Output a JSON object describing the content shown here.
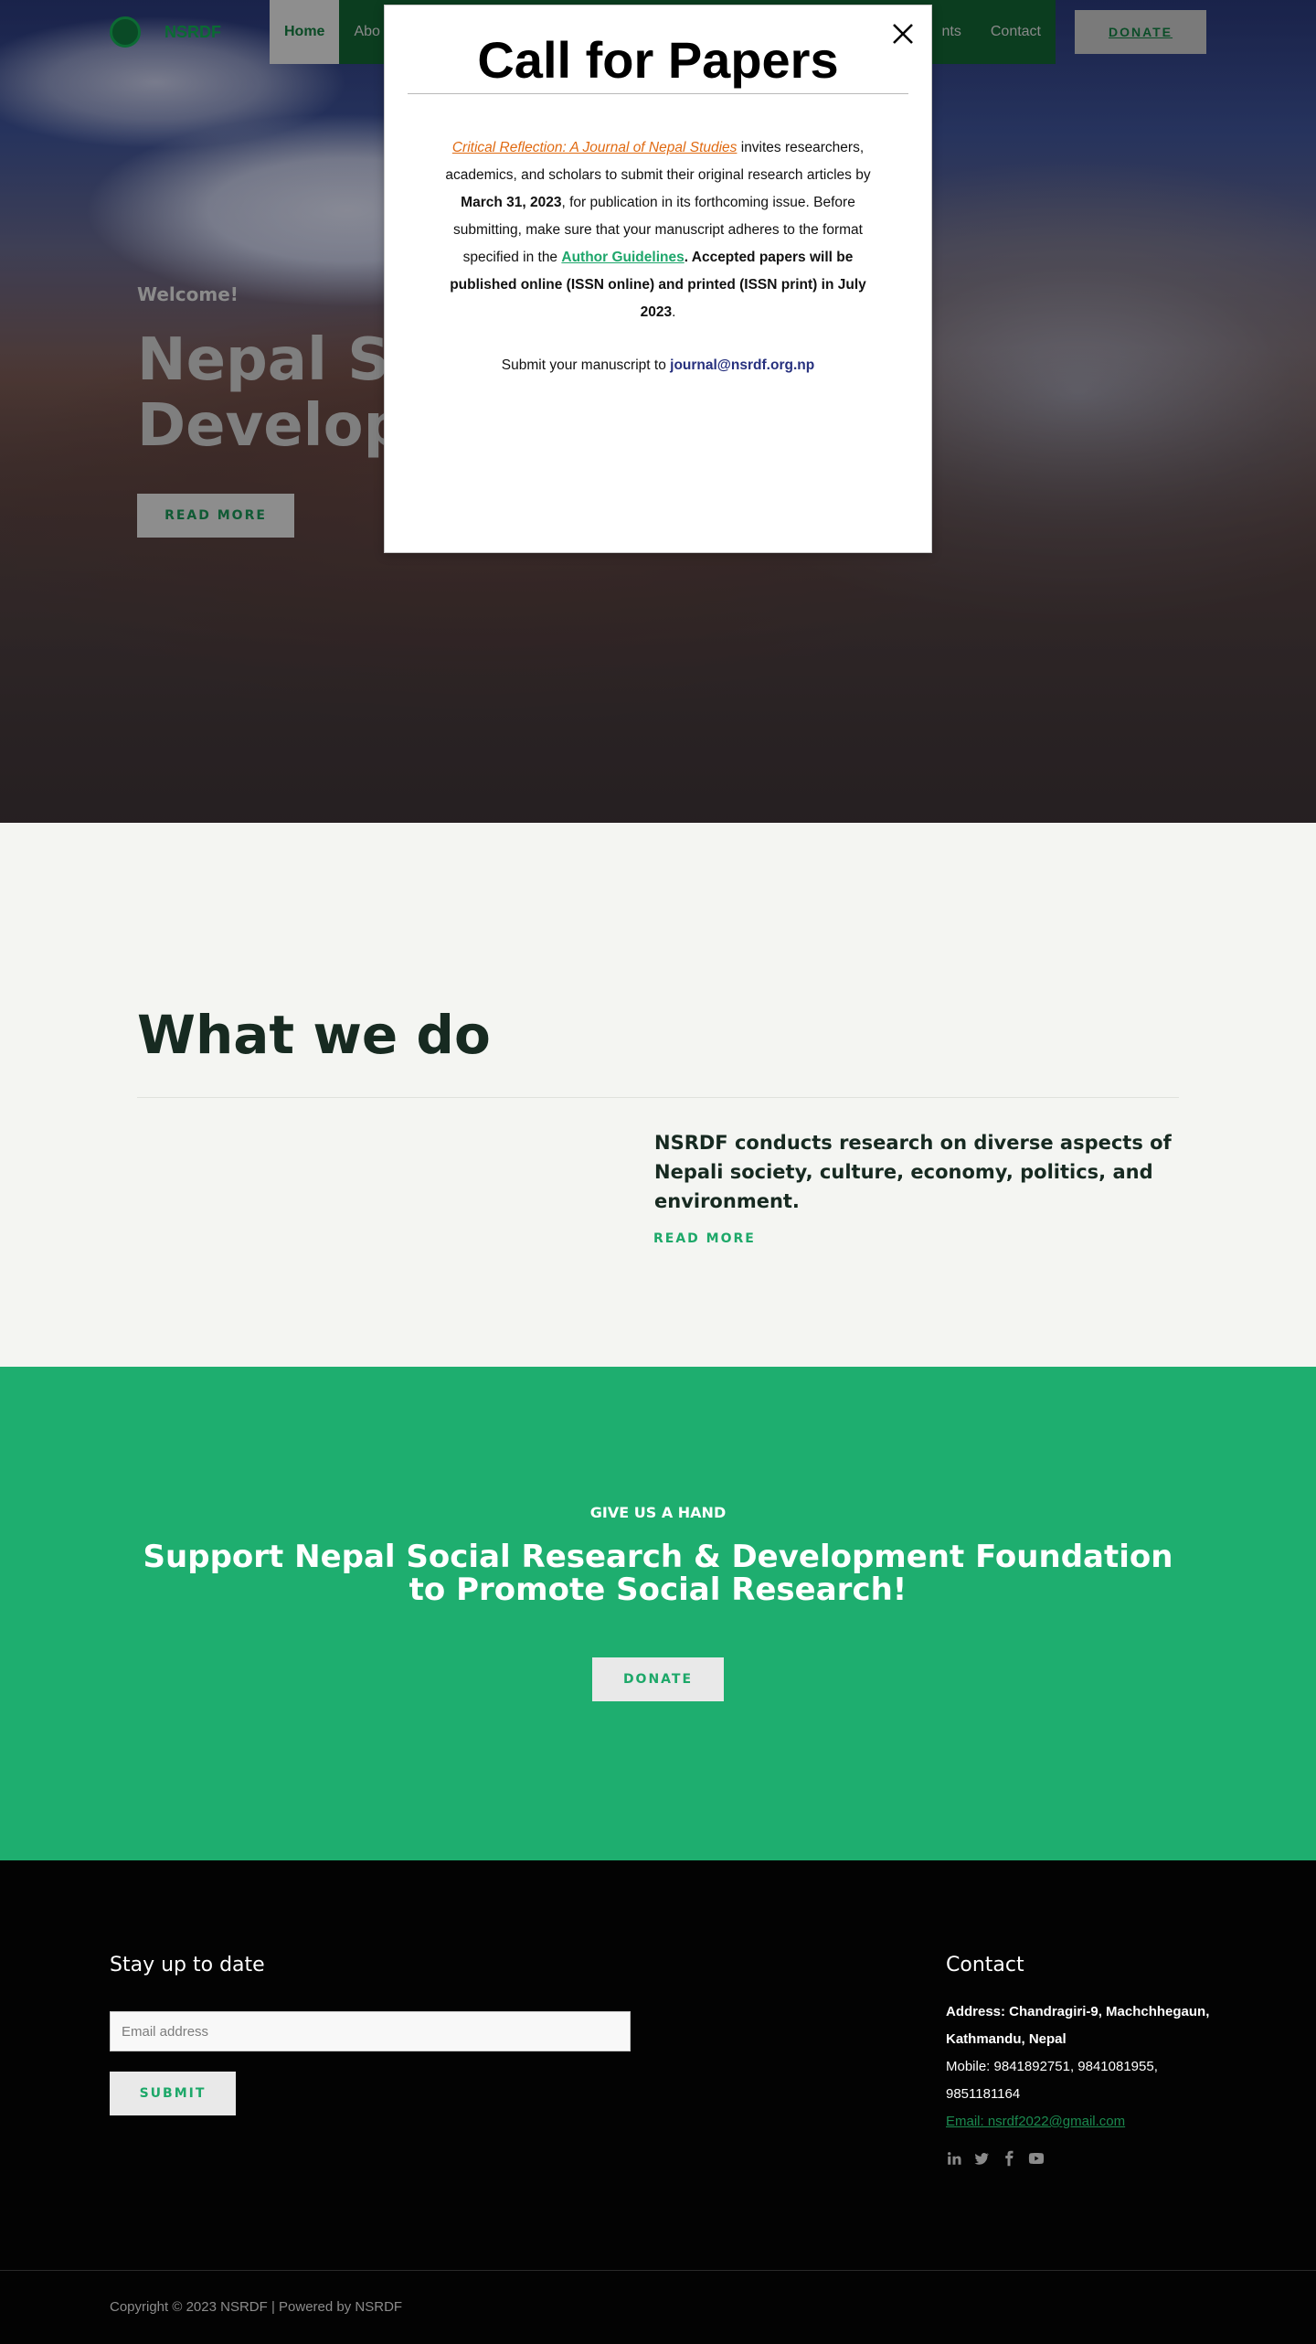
{
  "nav": {
    "logo_text": "NSRDF",
    "menu": [
      {
        "label": "Home",
        "active": true
      },
      {
        "label": "Abo",
        "active": false
      },
      {
        "label": "nts",
        "active": false
      },
      {
        "label": "Contact",
        "active": false
      }
    ],
    "donate_label": "DONATE"
  },
  "hero": {
    "welcome": "Welcome!",
    "title_line1": "Nepal Soc",
    "title_line2": "Developm",
    "read_more": "READ MORE"
  },
  "modal": {
    "title": "Call for Papers",
    "journal_name": "Critical Reflection: A Journal of Nepal Studies",
    "text1": " invites researchers, academics, and scholars to submit their original research articles by ",
    "deadline": "March 31, 2023",
    "text2": ", for publication in its forthcoming issue. Before submitting, make sure that your manuscript adheres to the format specified in the ",
    "guidelines_link": "Author Guidelines",
    "text3": ". Accepted papers will be published online (ISSN online) and printed (ISSN print) in ",
    "publish_date": "July 2023",
    "text4": ".",
    "submit_text": "Submit your manuscript to ",
    "submit_email": "journal@nsrdf.org.np"
  },
  "what_we_do": {
    "title": "What we do",
    "text": "NSRDF conducts research on diverse aspects of Nepali society, culture, economy, politics, and environment.",
    "read_more": "READ MORE"
  },
  "support": {
    "eyebrow": "GIVE US A HAND",
    "title": "Support Nepal Social Research & Development Foundation to Promote Social Research!",
    "donate_label": "DONATE"
  },
  "footer": {
    "stay_title": "Stay up to date",
    "email_placeholder": "Email address",
    "submit_label": "SUBMIT",
    "contact_title": "Contact",
    "address": "Address: Chandragiri-9, Machchhegaun, Kathmandu, Nepal",
    "mobile": "Mobile: 9841892751, 9841081955, 9851181164",
    "email": "Email: nsrdf2022@gmail.com",
    "social_icons": [
      "linkedin-icon",
      "twitter-icon",
      "facebook-icon",
      "youtube-icon"
    ],
    "copyright": "Copyright © 2023 NSRDF | Powered by NSRDF"
  },
  "colors": {
    "accent_green": "#1eae6f",
    "nav_green": "#0b3d1f",
    "journal_orange": "#e06a12",
    "email_blue": "#26307e"
  }
}
